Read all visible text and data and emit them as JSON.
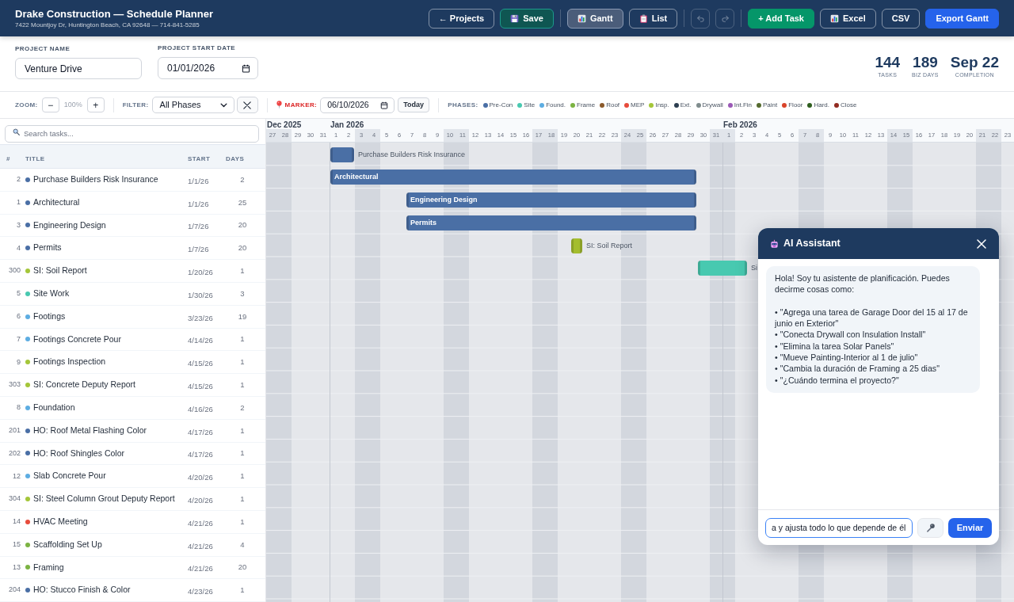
{
  "header": {
    "title": "Drake Construction — Schedule Planner",
    "subtitle": "7422 Mountjoy Dr, Huntington Beach, CA 92648 — 714-841-5285",
    "nav": [
      {
        "kind": "back",
        "label": "← Projects"
      },
      {
        "kind": "save",
        "label": "Save"
      }
    ],
    "views": [
      {
        "kind": "gantt",
        "label": "Gantt",
        "selected": true
      },
      {
        "kind": "list",
        "label": "List",
        "selected": false
      }
    ],
    "history": [
      {
        "kind": "undo",
        "disabled": true
      },
      {
        "kind": "redo",
        "disabled": true
      }
    ],
    "actions": [
      {
        "kind": "add",
        "label": "+ Add Task"
      },
      {
        "kind": "excel",
        "label": "Excel"
      },
      {
        "kind": "csv",
        "label": "CSV"
      },
      {
        "kind": "export",
        "label": "Export Gantt"
      }
    ]
  },
  "project": {
    "name": {
      "label": "PROJECT NAME",
      "value": "Venture Drive"
    },
    "start_date": {
      "label": "PROJECT START DATE",
      "value": "01/01/2026"
    }
  },
  "stats": [
    {
      "value": "144",
      "label": "TASKS"
    },
    {
      "value": "189",
      "label": "BIZ DAYS"
    },
    {
      "value": "Sep 22",
      "label": "COMPLETION"
    }
  ],
  "toolbar": {
    "zoom": {
      "label": "ZOOM:",
      "out": "−",
      "value": "100%",
      "in": "+"
    },
    "filter": {
      "label": "FILTER:",
      "value": "All Phases"
    },
    "marker": {
      "label": "MARKER:",
      "value": "06/10/2026",
      "today": "Today"
    },
    "phases": {
      "label": "PHASES:",
      "items": [
        {
          "label": "Pre-Con",
          "color": "#4a6fa5"
        },
        {
          "label": "Site",
          "color": "#48c9b0"
        },
        {
          "label": "Found.",
          "color": "#5dade2"
        },
        {
          "label": "Frame",
          "color": "#7cb342"
        },
        {
          "label": "Roof",
          "color": "#8b5a2b"
        },
        {
          "label": "MEP",
          "color": "#e74c3c"
        },
        {
          "label": "Insp.",
          "color": "#a4c639"
        },
        {
          "label": "Ext.",
          "color": "#2c3e50"
        },
        {
          "label": "Drywall",
          "color": "#7f8c8d"
        },
        {
          "label": "Int.Fin",
          "color": "#9b59b6"
        },
        {
          "label": "Paint",
          "color": "#556b2f"
        },
        {
          "label": "Floor",
          "color": "#d9442a"
        },
        {
          "label": "Hard.",
          "color": "#2e5e1e"
        },
        {
          "label": "Close",
          "color": "#922b21"
        }
      ]
    }
  },
  "search": {
    "placeholder": "Search tasks..."
  },
  "table": {
    "columns": [
      "#",
      "TITLE",
      "START",
      "DAYS"
    ],
    "rows": [
      {
        "id": "2",
        "title": "Purchase Builders Risk Insurance",
        "color": "#4a6fa5",
        "start": "1/1/26",
        "days": "2"
      },
      {
        "id": "1",
        "title": "Architectural",
        "color": "#4a6fa5",
        "start": "1/1/26",
        "days": "25"
      },
      {
        "id": "3",
        "title": "Engineering Design",
        "color": "#4a6fa5",
        "start": "1/7/26",
        "days": "20"
      },
      {
        "id": "4",
        "title": "Permits",
        "color": "#4a6fa5",
        "start": "1/7/26",
        "days": "20"
      },
      {
        "id": "300",
        "title": "SI: Soil Report",
        "color": "#a4c639",
        "start": "1/20/26",
        "days": "1"
      },
      {
        "id": "5",
        "title": "Site Work",
        "color": "#48c9b0",
        "start": "1/30/26",
        "days": "3"
      },
      {
        "id": "6",
        "title": "Footings",
        "color": "#5dade2",
        "start": "3/23/26",
        "days": "19"
      },
      {
        "id": "7",
        "title": "Footings Concrete Pour",
        "color": "#5dade2",
        "start": "4/14/26",
        "days": "1"
      },
      {
        "id": "9",
        "title": "Footings Inspection",
        "color": "#a4c639",
        "start": "4/15/26",
        "days": "1"
      },
      {
        "id": "303",
        "title": "SI: Concrete Deputy Report",
        "color": "#a4c639",
        "start": "4/15/26",
        "days": "1"
      },
      {
        "id": "8",
        "title": "Foundation",
        "color": "#5dade2",
        "start": "4/16/26",
        "days": "2"
      },
      {
        "id": "201",
        "title": "HO: Roof Metal Flashing Color",
        "color": "#4a6fa5",
        "start": "4/17/26",
        "days": "1"
      },
      {
        "id": "202",
        "title": "HO: Roof Shingles Color",
        "color": "#4a6fa5",
        "start": "4/17/26",
        "days": "1"
      },
      {
        "id": "12",
        "title": "Slab Concrete Pour",
        "color": "#5dade2",
        "start": "4/20/26",
        "days": "1"
      },
      {
        "id": "304",
        "title": "SI: Steel Column Grout Deputy Report",
        "color": "#a4c639",
        "start": "4/20/26",
        "days": "1"
      },
      {
        "id": "14",
        "title": "HVAC Meeting",
        "color": "#e74c3c",
        "start": "4/21/26",
        "days": "1"
      },
      {
        "id": "15",
        "title": "Scaffolding Set Up",
        "color": "#7cb342",
        "start": "4/21/26",
        "days": "4"
      },
      {
        "id": "13",
        "title": "Framing",
        "color": "#7cb342",
        "start": "4/21/26",
        "days": "20"
      },
      {
        "id": "204",
        "title": "HO: Stucco Finish & Color",
        "color": "#4a6fa5",
        "start": "4/23/26",
        "days": "1"
      }
    ]
  },
  "gantt": {
    "months": [
      {
        "label": "Dec 2025",
        "days": [
          {
            "label": "27",
            "weekend": true
          },
          {
            "label": "28",
            "weekend": true
          },
          {
            "label": "29",
            "weekend": false
          },
          {
            "label": "30",
            "weekend": false
          },
          {
            "label": "31",
            "weekend": false
          }
        ]
      },
      {
        "label": "Jan 2026",
        "days": [
          {
            "label": "1",
            "weekend": false
          },
          {
            "label": "2",
            "weekend": false
          },
          {
            "label": "3",
            "weekend": true
          },
          {
            "label": "4",
            "weekend": true
          },
          {
            "label": "5",
            "weekend": false
          },
          {
            "label": "6",
            "weekend": false
          },
          {
            "label": "7",
            "weekend": false
          },
          {
            "label": "8",
            "weekend": false
          },
          {
            "label": "9",
            "weekend": false
          },
          {
            "label": "10",
            "weekend": true
          },
          {
            "label": "11",
            "weekend": true
          },
          {
            "label": "12",
            "weekend": false
          },
          {
            "label": "13",
            "weekend": false
          },
          {
            "label": "14",
            "weekend": false
          },
          {
            "label": "15",
            "weekend": false
          },
          {
            "label": "16",
            "weekend": false
          },
          {
            "label": "17",
            "weekend": true
          },
          {
            "label": "18",
            "weekend": true
          },
          {
            "label": "19",
            "weekend": false
          },
          {
            "label": "20",
            "weekend": false
          },
          {
            "label": "21",
            "weekend": false
          },
          {
            "label": "22",
            "weekend": false
          },
          {
            "label": "23",
            "weekend": false
          },
          {
            "label": "24",
            "weekend": true
          },
          {
            "label": "25",
            "weekend": true
          },
          {
            "label": "26",
            "weekend": false
          },
          {
            "label": "27",
            "weekend": false
          },
          {
            "label": "28",
            "weekend": false
          },
          {
            "label": "29",
            "weekend": false
          },
          {
            "label": "30",
            "weekend": false
          },
          {
            "label": "31",
            "weekend": true
          }
        ]
      },
      {
        "label": "Feb 2026",
        "days": [
          {
            "label": "1",
            "weekend": true
          },
          {
            "label": "2",
            "weekend": false
          },
          {
            "label": "3",
            "weekend": false
          },
          {
            "label": "4",
            "weekend": false
          },
          {
            "label": "5",
            "weekend": false
          },
          {
            "label": "6",
            "weekend": false
          },
          {
            "label": "7",
            "weekend": true
          },
          {
            "label": "8",
            "weekend": true
          },
          {
            "label": "9",
            "weekend": false
          },
          {
            "label": "10",
            "weekend": false
          },
          {
            "label": "11",
            "weekend": false
          },
          {
            "label": "12",
            "weekend": false
          },
          {
            "label": "13",
            "weekend": false
          },
          {
            "label": "14",
            "weekend": true
          },
          {
            "label": "15",
            "weekend": true
          },
          {
            "label": "16",
            "weekend": false
          },
          {
            "label": "17",
            "weekend": false
          },
          {
            "label": "18",
            "weekend": false
          },
          {
            "label": "19",
            "weekend": false
          },
          {
            "label": "20",
            "weekend": false
          },
          {
            "label": "21",
            "weekend": true
          },
          {
            "label": "22",
            "weekend": true
          },
          {
            "label": "23",
            "weekend": false
          }
        ]
      }
    ],
    "bars": [
      {
        "label": "Purchase Builders Risk Insurance",
        "color": "#4a6fa5",
        "start": {
          "level": 0.0847
        },
        "end": {
          "level": 0.1186
        }
      },
      {
        "label": "Architectural",
        "color": "#4a6fa5",
        "start": {
          "level": 0.0847
        },
        "end": {
          "level": 0.5763
        }
      },
      {
        "label": "Engineering Design",
        "color": "#4a6fa5",
        "start": {
          "level": 0.1864
        },
        "end": {
          "level": 0.5763
        }
      },
      {
        "label": "Permits",
        "color": "#4a6fa5",
        "start": {
          "level": 0.1864
        },
        "end": {
          "level": 0.5763
        }
      },
      {
        "label": "SI: Soil Report",
        "color": "#a4bd2e",
        "start": {
          "level": 0.4068
        },
        "end": {
          "level": 0.4237
        }
      },
      {
        "label": "Si",
        "color": "#48c9b0",
        "start": {
          "level": 0.5763
        },
        "end": {
          "level": 0.6441
        }
      }
    ]
  },
  "assistant": {
    "title": "AI Assistant",
    "messages": [
      {
        "text": "Hola! Soy tu asistente de planificación. Puedes decirme cosas como:\n\n• \"Agrega una tarea de Garage Door del 15 al 17 de junio en Exterior\"\n• \"Conecta Drywall con Insulation Install\"\n• \"Elimina la tarea Solar Panels\"\n• \"Mueve Painting-Interior al 1 de julio\"\n• \"Cambia la duración de Framing a 25 dias\"\n• \"¿Cuándo termina el proyecto?\""
      }
    ],
    "input_value": "a y ajusta todo lo que depende de él",
    "send": "Enviar"
  }
}
